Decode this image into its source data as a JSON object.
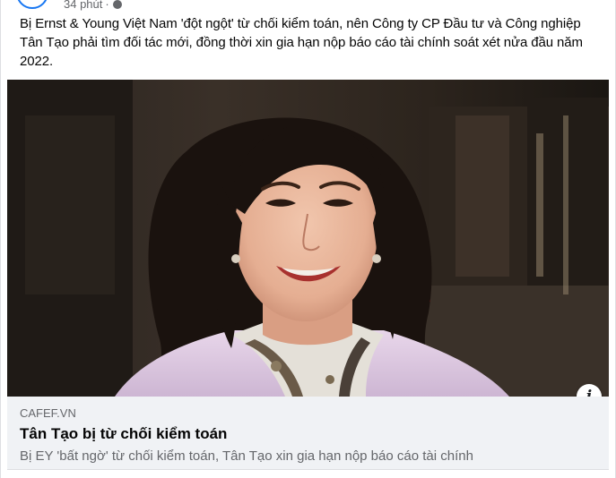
{
  "post": {
    "timestamp": "34 phút",
    "separator": "·",
    "privacy_icon": "globe-icon",
    "text": "Bị Ernst & Young Việt Nam 'đột ngột' từ chối kiểm toán, nên Công ty CP Đầu tư và Công nghiệp Tân Tạo phải tìm đối tác mới, đồng thời xin gia hạn nộp báo cáo tài chính soát xét nửa đầu năm 2022."
  },
  "link": {
    "domain": "CAFEF.VN",
    "title": "Tân Tạo bị từ chối kiểm toán",
    "description": "Bị EY 'bất ngờ' từ chối kiểm toán, Tân Tạo xin gia hạn nộp báo cáo tài chính",
    "info_icon_glyph": "i",
    "info_icon": "info-icon",
    "image": "woman-portrait-photo"
  },
  "colors": {
    "accent": "#1877f2",
    "text_primary": "#050505",
    "text_secondary": "#65676b",
    "card_bg": "#f0f2f5"
  }
}
